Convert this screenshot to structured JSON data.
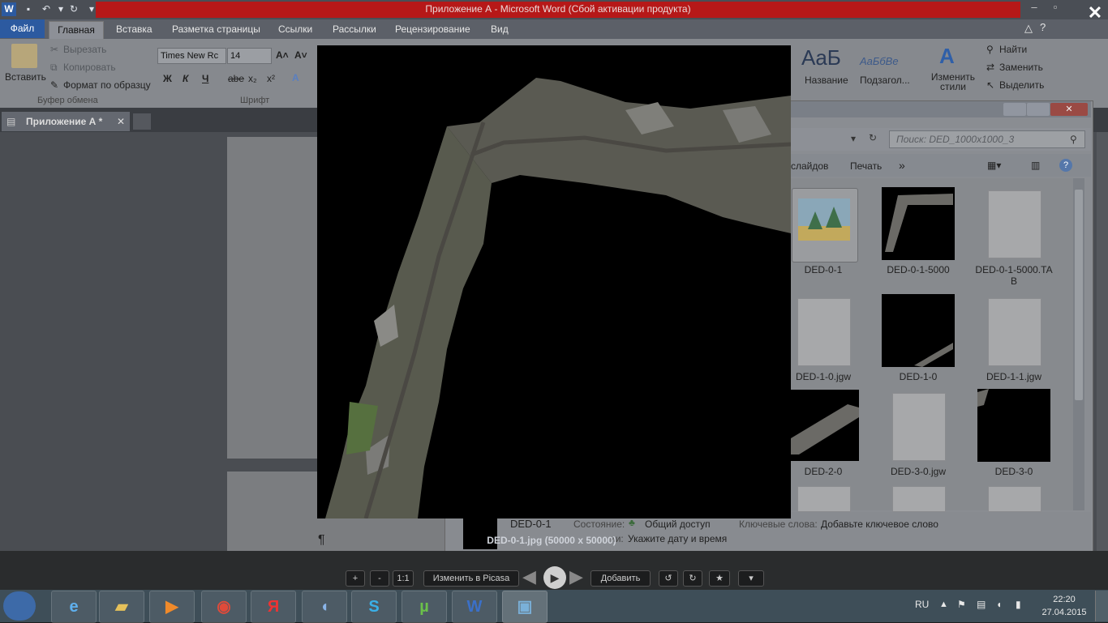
{
  "word": {
    "title": "Приложение А  -  Microsoft Word (Сбой активации продукта)",
    "tabs": [
      "Файл",
      "Главная",
      "Вставка",
      "Разметка страницы",
      "Ссылки",
      "Рассылки",
      "Рецензирование",
      "Вид"
    ],
    "clipboard": {
      "paste": "Вставить",
      "cut": "Вырезать",
      "copy": "Копировать",
      "format_painter": "Формат по образцу",
      "group_label": "Буфер обмена"
    },
    "font": {
      "name": "Times New Rc",
      "size": "14",
      "group_label": "Шрифт",
      "bold": "Ж",
      "italic": "К",
      "underline": "Ч",
      "strike": "abe",
      "subscript": "x₂",
      "superscript": "x²"
    },
    "styles": {
      "sample_title": "AaБ",
      "sample_subtitle": "АаБбВе",
      "title_label": "Название",
      "subtitle_label": "Подзагол...",
      "change_styles": "Изменить стили"
    },
    "editing": {
      "find": "Найти",
      "replace": "Заменить",
      "select": "Выделить"
    },
    "doc_tab": "Приложение А  *",
    "pilcrow": "¶"
  },
  "explorer": {
    "search_placeholder": "Поиск: DED_1000x1000_3",
    "toolbar": {
      "slideshow": "слайдов",
      "print": "Печать",
      "more": "»"
    },
    "files": [
      {
        "name": "DED-0-1",
        "kind": "picture-icon"
      },
      {
        "name": "DED-0-1-5000",
        "kind": "map-thumb"
      },
      {
        "name": "DED-0-1-5000.TA\nB",
        "kind": "blank"
      },
      {
        "name": "DED-1-0.jgw",
        "kind": "blank"
      },
      {
        "name": "DED-1-0",
        "kind": "dark"
      },
      {
        "name": "DED-1-1.jgw",
        "kind": "blank"
      },
      {
        "name": "DED-2-0",
        "kind": "map-thumb"
      },
      {
        "name": "DED-3-0.jgw",
        "kind": "blank"
      },
      {
        "name": "DED-3-0",
        "kind": "dark"
      }
    ],
    "details": {
      "name": "DED-0-1",
      "state_label": "Состояние:",
      "state_value": "Общий доступ",
      "keywords_label": "Ключевые слова:",
      "keywords_value": "Добавьте ключевое слово",
      "date_hint": "Укажите дату и время",
      "date_label_suffix": "ии:"
    }
  },
  "viewer": {
    "caption": "DED-0-1.jpg (50000 x 50000)"
  },
  "picasa": {
    "zoom_in": "+",
    "zoom_out": "-",
    "actual_size": "1:1",
    "edit": "Изменить в Picasa",
    "add": "Добавить"
  },
  "taskbar": {
    "lang": "RU",
    "time": "22:20",
    "date": "27.04.2015",
    "apps": [
      "ie-icon",
      "explorer-icon",
      "media-icon",
      "chrome-icon",
      "yandex-icon",
      "speaker-app-icon",
      "skype-icon",
      "utorrent-icon",
      "word-icon",
      "picasa-icon"
    ],
    "yandex_glyph": "Я",
    "word_glyph": "W"
  },
  "colors": {
    "title_red": "#b61818",
    "file_tab_blue": "#2c5aa0"
  }
}
